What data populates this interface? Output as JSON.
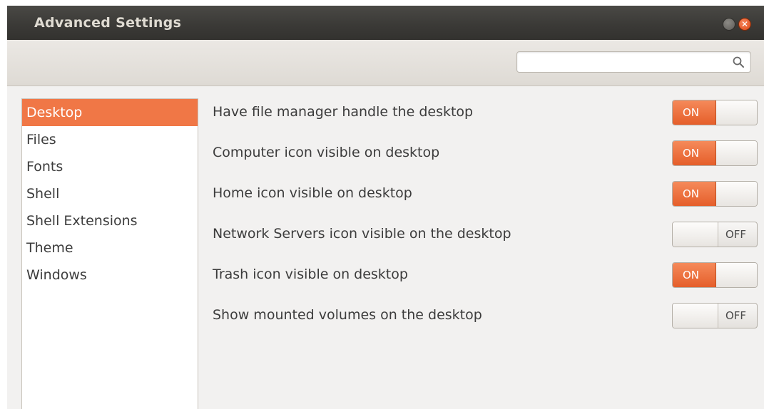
{
  "window": {
    "title": "Advanced Settings",
    "close_glyph": "✕"
  },
  "search": {
    "value": "",
    "placeholder": ""
  },
  "sidebar": {
    "items": [
      {
        "label": "Desktop",
        "selected": true
      },
      {
        "label": "Files",
        "selected": false
      },
      {
        "label": "Fonts",
        "selected": false
      },
      {
        "label": "Shell",
        "selected": false
      },
      {
        "label": "Shell Extensions",
        "selected": false
      },
      {
        "label": "Theme",
        "selected": false
      },
      {
        "label": "Windows",
        "selected": false
      }
    ]
  },
  "settings": [
    {
      "label": "Have file manager handle the desktop",
      "state": "ON"
    },
    {
      "label": "Computer icon visible on desktop",
      "state": "ON"
    },
    {
      "label": "Home icon visible on desktop",
      "state": "ON"
    },
    {
      "label": "Network Servers icon visible on the desktop",
      "state": "OFF"
    },
    {
      "label": "Trash icon visible on desktop",
      "state": "ON"
    },
    {
      "label": "Show mounted volumes on the desktop",
      "state": "OFF"
    }
  ],
  "colors": {
    "accent": "#f07746",
    "titlebar": "#3c3b37",
    "background": "#f2f1f0"
  },
  "icons": {
    "search": "search-icon",
    "close": "close-icon",
    "minimize": "minimize-icon"
  }
}
